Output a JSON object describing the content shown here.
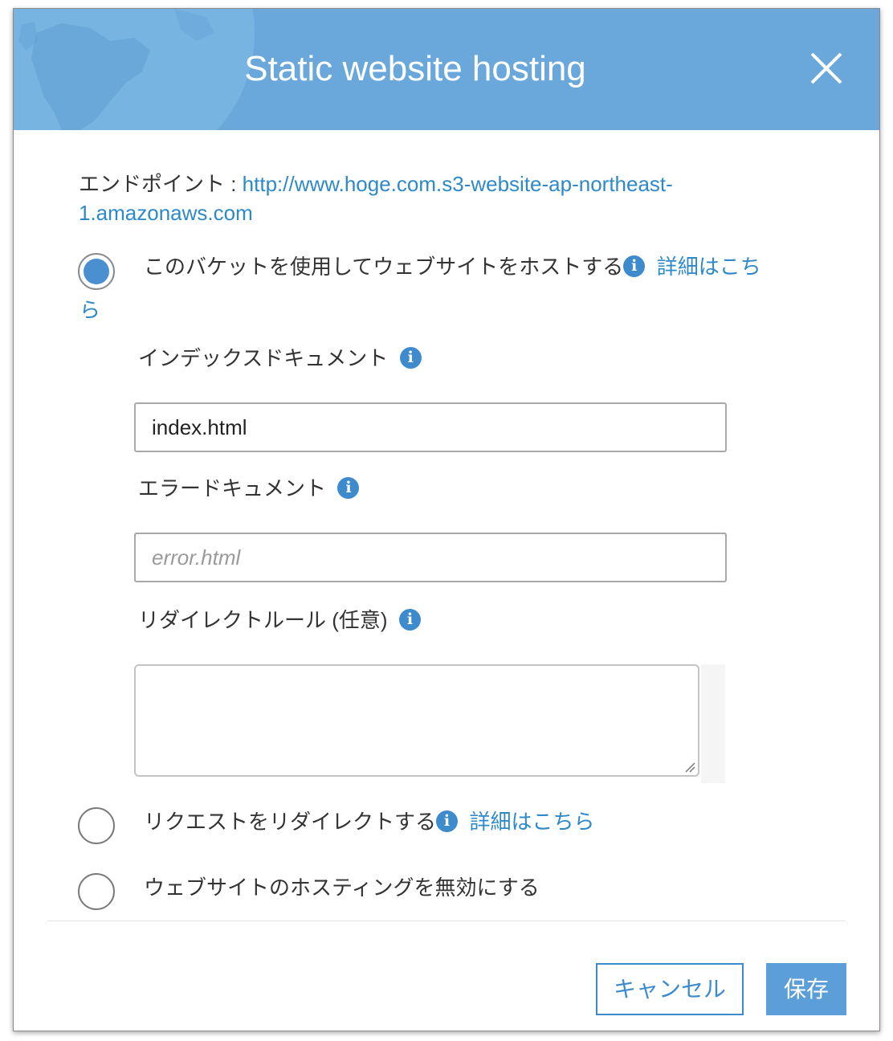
{
  "dialog": {
    "title": "Static website hosting",
    "close_icon": "close-icon"
  },
  "endpoint": {
    "label": "エンドポイント : ",
    "url_line1": "http://www.hoge.com.s3-website-ap-northeast-",
    "url_line2": "1.amazonaws.com"
  },
  "options": [
    {
      "label": "このバケットを使用してウェブサイトをホストする",
      "link_line1": "詳細はこち",
      "link_line2": "ら",
      "selected": true
    },
    {
      "label": "リクエストをリダイレクトする",
      "link": "詳細はこちら",
      "selected": false
    },
    {
      "label": "ウェブサイトのホスティングを無効にする",
      "selected": false
    }
  ],
  "fields": {
    "index_label": "インデックスドキュメント",
    "index_value": "index.html",
    "error_label": "エラードキュメント",
    "error_placeholder": "error.html",
    "redirect_label": "リダイレクトルール (任意)",
    "redirect_value": ""
  },
  "info_glyph": "i",
  "buttons": {
    "cancel": "キャンセル",
    "save": "保存"
  },
  "colors": {
    "header": "#6aa8dc",
    "accent": "#3d8bcd",
    "link": "#2e89c9",
    "save_button": "#5c9fd8"
  }
}
